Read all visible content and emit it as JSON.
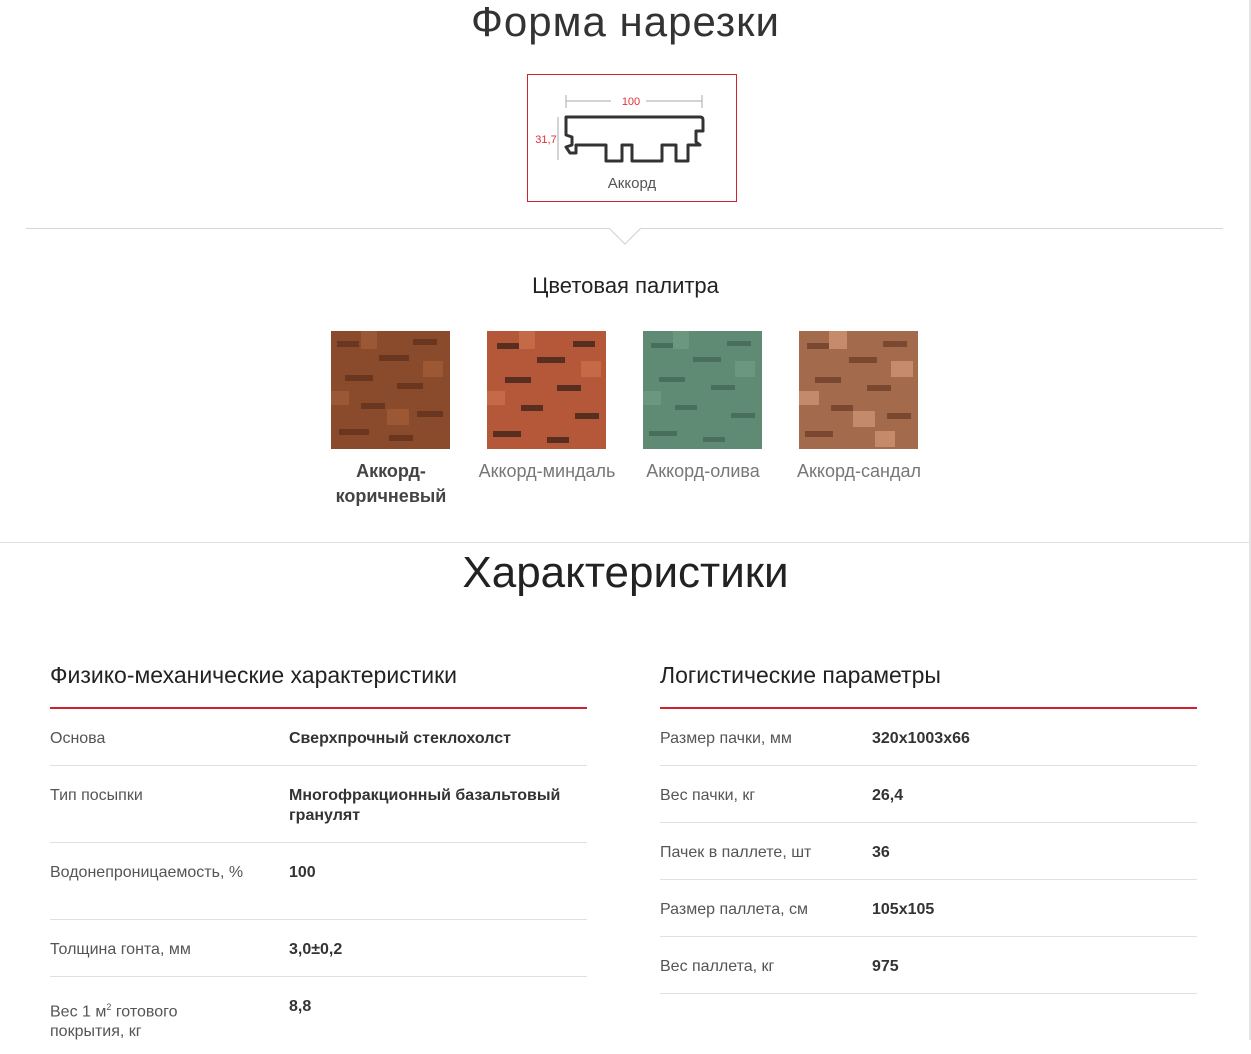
{
  "cut_section": {
    "title": "Форма нарезки",
    "shape": {
      "name": "Аккорд",
      "width_label": "100",
      "height_label": "31,7"
    }
  },
  "palette_section": {
    "title": "Цветовая палитра",
    "swatches": [
      {
        "name": "Аккорд-коричневый",
        "color": "#8a4a2c",
        "active": true
      },
      {
        "name": "Аккорд-миндаль",
        "color": "#b5583a",
        "active": false
      },
      {
        "name": "Аккорд-олива",
        "color": "#5f8a73",
        "active": false
      },
      {
        "name": "Аккорд-сандал",
        "color": "#a36a4c",
        "active": false
      }
    ]
  },
  "characteristics_section": {
    "title": "Характеристики",
    "physical": {
      "title": "Физико-механические характеристики",
      "rows": [
        {
          "label": "Основа",
          "value": "Сверхпрочный стеклохолст"
        },
        {
          "label": "Тип посыпки",
          "value": "Многофракционный базальтовый гранулят"
        },
        {
          "label": "Водонепроницаемость, %",
          "value": "100"
        },
        {
          "label": "Толщина гонта, мм",
          "value": "3,0±0,2"
        },
        {
          "label_prefix": "Вес 1 м",
          "label_sup": "2",
          "label_suffix": " готового покрытия, кг",
          "value": "8,8"
        }
      ]
    },
    "logistics": {
      "title": "Логистические параметры",
      "rows": [
        {
          "label": "Размер пачки, мм",
          "value": "320x1003x66"
        },
        {
          "label": "Вес пачки, кг",
          "value": "26,4"
        },
        {
          "label": "Пачек в паллете, шт",
          "value": "36"
        },
        {
          "label": "Размер паллета, см",
          "value": "105x105"
        },
        {
          "label": "Вес паллета, кг",
          "value": "975"
        }
      ]
    }
  },
  "colors": {
    "accent": "#d0222c",
    "dimension_text": "#e0303a"
  }
}
